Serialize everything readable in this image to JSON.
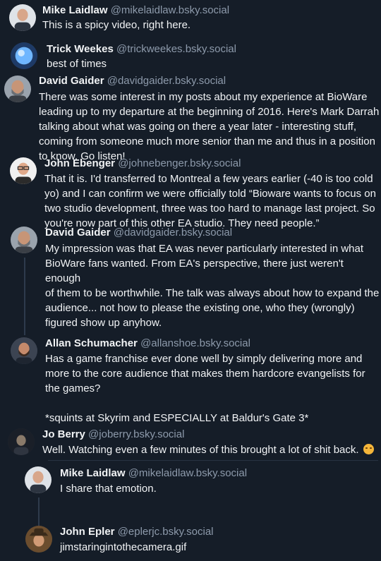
{
  "posts": [
    {
      "name": "Mike Laidlaw",
      "handle": "@mikelaidlaw.bsky.social",
      "text": "This is a spicy video, right here.",
      "avatar": "bald-man-avatar"
    },
    {
      "name": "Trick Weekes",
      "handle": "@trickweekes.bsky.social",
      "text": "best of times",
      "avatar": "blue-orb-avatar"
    },
    {
      "name": "David Gaider",
      "handle": "@davidgaider.bsky.social",
      "text": "There was some interest in my posts about my experience at BioWare\nleading up to my departure at the beginning of 2016. Here's Mark Darrah\ntalking about what was going on there a year later - interesting stuff,\ncoming from someone much more senior than me and thus in a position\nto know. Go listen!",
      "avatar": "bearded-man-avatar"
    },
    {
      "name": "John Ebenger",
      "handle": "@johnebenger.bsky.social",
      "text": "That it is. I'd transferred to Montreal a few years earlier (-40 is too cold\nyo) and I can confirm we were officially told “Bioware wants to focus on\ntwo studio development, three was too hard to manage last project. So\nyou're now part of this other EA studio. They need people.”",
      "avatar": "glasses-man-avatar"
    },
    {
      "name": "David Gaider",
      "handle": "@davidgaider.bsky.social",
      "text": "My impression was that EA was never particularly interested in what\nBioWare fans wanted. From EA's perspective, there just weren't enough\nof them to be worthwhile. The talk was always about how to expand the\naudience... not how to please the existing one, who they (wrongly)\nfigured show up anyhow.",
      "avatar": "bearded-man-avatar"
    },
    {
      "name": "Allan Schumacher",
      "handle": "@allanshoe.bsky.social",
      "text": "Has a game franchise ever done well by simply delivering more and\nmore to the core audience that makes them hardcore evangelists for\nthe games?\n\n*squints at Skyrim and ESPECIALLY at Baldur's Gate 3*",
      "avatar": "bearded-man-dark-avatar"
    },
    {
      "name": "Jo Berry",
      "handle": "@joberry.bsky.social",
      "text": "Well. Watching even a few minutes of this brought a lot of shit back.",
      "avatar": "dark-scene-avatar",
      "emoji": "sad-face-emoji"
    },
    {
      "name": "Mike Laidlaw",
      "handle": "@mikelaidlaw.bsky.social",
      "text": "I share that emotion.",
      "avatar": "bald-man-avatar"
    },
    {
      "name": "John Epler",
      "handle": "@eplerjc.bsky.social",
      "text": "jimstaringintothecamera.gif",
      "avatar": "hat-man-avatar"
    }
  ]
}
